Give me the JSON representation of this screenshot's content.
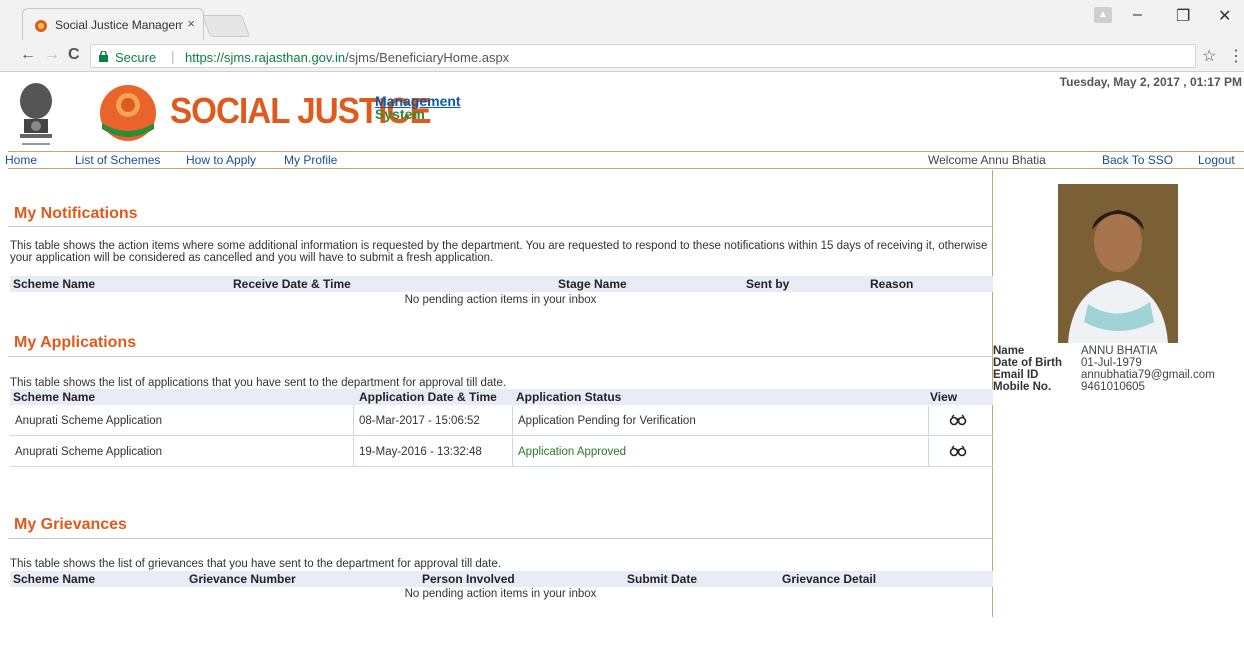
{
  "browser": {
    "tab_title": "Social Justice Manageme",
    "tab_close": "×",
    "secure_label": "Secure",
    "url_host": "https://sjms.rajasthan.gov.in",
    "url_path": "/sjms/BeneficiaryHome.aspx",
    "back_icon": "←",
    "forward_icon": "→",
    "reload_icon": "C",
    "star_icon": "☆",
    "menu_icon": "⋮",
    "minimize_icon": "–",
    "restore_icon": "❐",
    "close_icon": "✕"
  },
  "header": {
    "logo_title": "SOCIAL JUSTICE",
    "logo_sub1": "Management",
    "logo_sub2": "System",
    "datetime": "Tuesday, May 2, 2017 , 01:17 PM"
  },
  "nav": {
    "items": [
      "Home",
      "List of Schemes",
      "How to Apply",
      "My Profile"
    ],
    "welcome": "Welcome Annu Bhatia",
    "back_to_sso": "Back To SSO",
    "logout": "Logout"
  },
  "notifications": {
    "title": "My Notifications",
    "description": "This table shows the action items where some additional information is requested by the department. You are requested to respond to these notifications within 15 days of receiving it, otherwise your application will be considered as cancelled and you will have to submit a fresh application.",
    "columns": [
      "Scheme Name",
      "Receive Date & Time",
      "Stage Name",
      "Sent by",
      "Reason"
    ],
    "empty": "No pending action items in your inbox"
  },
  "applications": {
    "title": "My Applications",
    "description": "This table shows the list of applications that you have sent to the department for approval till date.",
    "columns": [
      "Scheme Name",
      "Application Date & Time",
      "Application Status",
      "View"
    ],
    "rows": [
      {
        "scheme": "Anuprati Scheme Application",
        "datetime": "08-Mar-2017 - 15:06:52",
        "status": "Application Pending for Verification"
      },
      {
        "scheme": "Anuprati Scheme Application",
        "datetime": "19-May-2016 - 13:32:48",
        "status": "Application Approved"
      }
    ]
  },
  "grievances": {
    "title": "My Grievances",
    "description": "This table shows the list of grievances that you have sent to the department for approval till date.",
    "columns": [
      "Scheme Name",
      "Grievance Number",
      "Person Involved",
      "Submit Date",
      "Grievance Detail"
    ],
    "empty": "No pending action items in your inbox"
  },
  "profile": {
    "labels": {
      "name": "Name",
      "dob": "Date of Birth",
      "email": "Email ID",
      "mobile": "Mobile No."
    },
    "values": {
      "name": "ANNU BHATIA",
      "dob": "01-Jul-1979",
      "email": "annubhatia79@gmail.com",
      "mobile": "9461010605"
    }
  },
  "colors": {
    "accent_orange": "#e05a1b",
    "link_blue": "#1a4c9a",
    "secure_green": "#0b8043",
    "approved_green": "#2a7a2a",
    "header_row_bg": "#e8edf5"
  }
}
